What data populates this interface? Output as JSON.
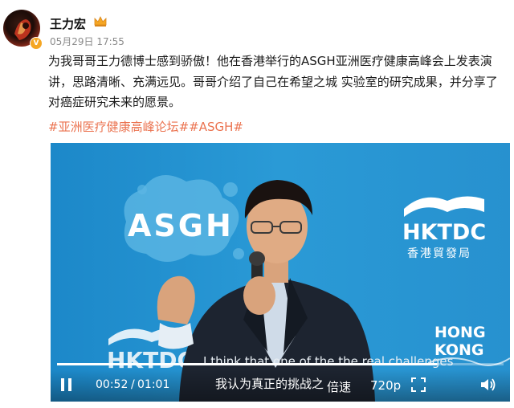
{
  "post": {
    "username": "王力宏",
    "verified_badge": "V",
    "timestamp": "05月29日 17:55",
    "text": "为我哥哥王力德博士感到骄傲！他在香港举行的ASGH亚洲医疗健康高峰会上发表演讲，思路清晰、充满远见。哥哥介绍了自己在希望之城 实验室的研究成果，并分享了对癌症研究未来的愿景。",
    "hashtags": "#亚洲医疗健康高峰论坛##ASGH#"
  },
  "video": {
    "logo_asgh": "ASGH",
    "logo_hktdc": "HKTDC",
    "hktdc_chinese": "香港貿發局",
    "logo_hongkong_line1": "HONG",
    "logo_hongkong_line2": "KONG",
    "logo_hktdc_bottom": "HKTDC",
    "caption_en": "I think that one of the the real challenges",
    "caption_zh": "我认为真正的挑战之",
    "controls": {
      "current_time": "00:52",
      "separator": "/",
      "duration": "01:01",
      "speed_label": "倍速",
      "quality_label": "720p",
      "progress": 0.85
    }
  },
  "icons": {
    "crown": "crown-icon",
    "pause": "pause-icon",
    "fullscreen": "fullscreen-icon",
    "volume": "volume-icon"
  },
  "colors": {
    "hashtag": "#eb7350",
    "video_bg": "#2294d2",
    "timestamp": "#8a8a8a"
  }
}
